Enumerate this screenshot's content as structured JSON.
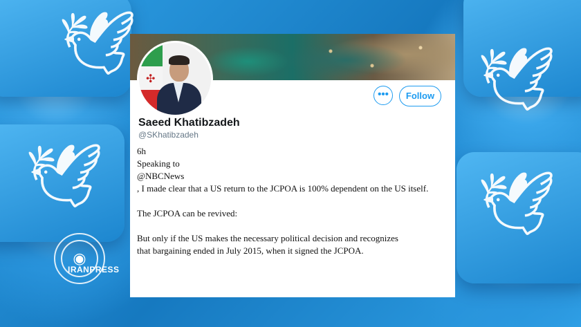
{
  "profile": {
    "name": "Saeed Khatibzadeh",
    "handle": "@SKhatibzadeh",
    "avatar_icon": "person-portrait-icon",
    "banner_icon": "satellite-map-banner"
  },
  "actions": {
    "more_label": "•••",
    "follow_label": "Follow"
  },
  "tweet": {
    "time": "6h",
    "lines": [
      "Speaking to",
      "@NBCNews",
      ", I made clear that a US return to the JCPOA is 100% dependent on the US itself.",
      "The JCPOA can be revived:",
      "But only if the US makes the necessary political decision and recognizes",
      " that bargaining ended in July 2015, when it signed the JCPOA."
    ]
  },
  "watermark": {
    "text": "IRANPRESS"
  },
  "colors": {
    "accent": "#1d9bf0",
    "background": "#1d8fd6"
  }
}
